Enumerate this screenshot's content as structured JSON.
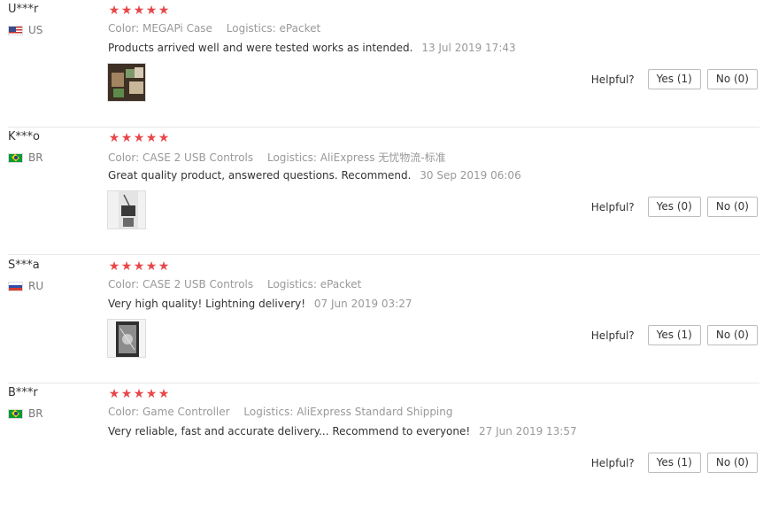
{
  "helpful_label": "Helpful?",
  "reviews": [
    {
      "user": "U***r",
      "country": "US",
      "rating": 5,
      "color_label": "Color:",
      "color_value": "MEGAPi Case",
      "logistics_label": "Logistics:",
      "logistics_value": "ePacket",
      "text": "Products arrived well and were tested works as intended.",
      "date": "13 Jul 2019 17:43",
      "yes": "Yes (1)",
      "no": "No (0)"
    },
    {
      "user": "K***o",
      "country": "BR",
      "rating": 5,
      "color_label": "Color:",
      "color_value": "CASE 2 USB Controls",
      "logistics_label": "Logistics:",
      "logistics_value": "AliExpress 无忧物流-标准",
      "text": "Great quality product, answered questions. Recommend.",
      "date": "30 Sep 2019 06:06",
      "yes": "Yes (0)",
      "no": "No (0)"
    },
    {
      "user": "S***a",
      "country": "RU",
      "rating": 5,
      "color_label": "Color:",
      "color_value": "CASE 2 USB Controls",
      "logistics_label": "Logistics:",
      "logistics_value": "ePacket",
      "text": "Very high quality! Lightning delivery!",
      "date": "07 Jun 2019 03:27",
      "yes": "Yes (1)",
      "no": "No (0)"
    },
    {
      "user": "B***r",
      "country": "BR",
      "rating": 5,
      "color_label": "Color:",
      "color_value": "Game Controller",
      "logistics_label": "Logistics:",
      "logistics_value": "AliExpress Standard Shipping",
      "text": "Very reliable, fast and accurate delivery... Recommend to everyone!",
      "date": "27 Jun 2019 13:57",
      "yes": "Yes (1)",
      "no": "No (0)"
    }
  ]
}
